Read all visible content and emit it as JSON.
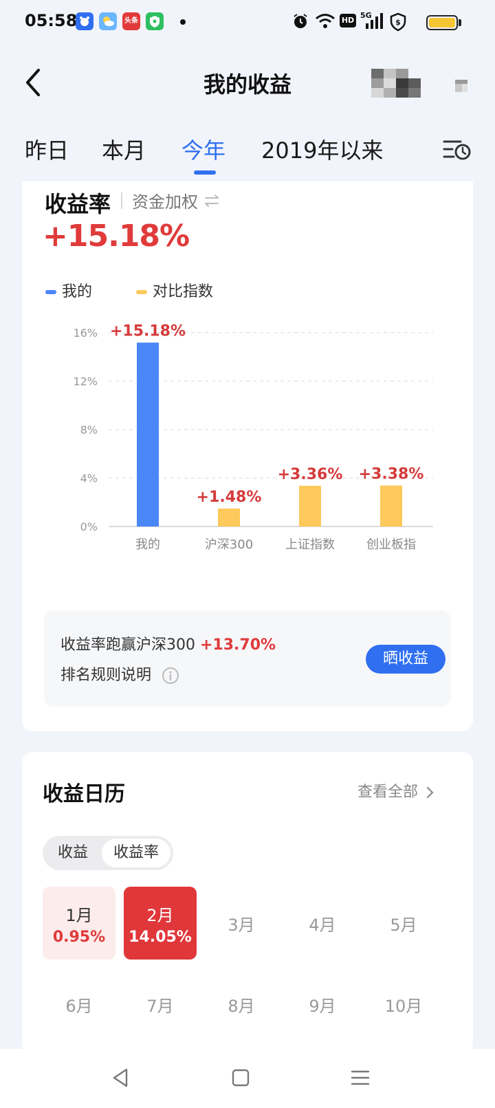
{
  "status_bar": {
    "time": "05:58",
    "icons": [
      "baidu-app-icon",
      "weather-app-icon",
      "toutiao-app-icon",
      "security-app-icon",
      "alarm-icon",
      "wifi-icon",
      "hd-icon",
      "signal-5g-icon",
      "shield-dollar-icon",
      "battery-icon"
    ],
    "toutiao_label": "头条",
    "hd_label": "HD",
    "net_label": "5G"
  },
  "header": {
    "title": "我的收益"
  },
  "tabs": [
    {
      "label": "昨日",
      "active": false
    },
    {
      "label": "本月",
      "active": false
    },
    {
      "label": "今年",
      "active": true
    },
    {
      "label": "2019年以来",
      "active": false
    }
  ],
  "rate_card": {
    "title": "收益率",
    "subtitle": "资金加权",
    "value": "+15.18%",
    "legend": [
      {
        "label": "我的",
        "color": "#4a86f6"
      },
      {
        "label": "对比指数",
        "color": "#fcc95a"
      }
    ]
  },
  "chart_data": {
    "type": "bar",
    "categories": [
      "我的",
      "沪深300",
      "上证指数",
      "创业板指"
    ],
    "values": [
      15.18,
      1.48,
      3.36,
      3.38
    ],
    "value_labels": [
      "+15.18%",
      "+1.48%",
      "+3.36%",
      "+3.38%"
    ],
    "colors": [
      "#4a86f6",
      "#fcc95a",
      "#fcc95a",
      "#fcc95a"
    ],
    "yticks": [
      "0%",
      "4%",
      "8%",
      "12%",
      "16%"
    ],
    "ylim": [
      0,
      16
    ],
    "grid": true,
    "label_color": "#d63a3a"
  },
  "compare": {
    "text": "收益率跑赢沪深300",
    "diff": "+13.70%",
    "rules": "排名规则说明",
    "share_button": "晒收益"
  },
  "calendar": {
    "title": "收益日历",
    "view_all": "查看全部",
    "toggle": [
      {
        "label": "收益",
        "selected": false
      },
      {
        "label": "收益率",
        "selected": true
      }
    ],
    "months_row1": [
      {
        "name": "1月",
        "value": "0.95%",
        "style": "light"
      },
      {
        "name": "2月",
        "value": "14.05%",
        "style": "strong"
      },
      {
        "name": "3月",
        "value": "",
        "style": "plain"
      },
      {
        "name": "4月",
        "value": "",
        "style": "plain"
      },
      {
        "name": "5月",
        "value": "",
        "style": "plain"
      }
    ],
    "months_row2": [
      {
        "name": "6月",
        "value": "",
        "style": "plain"
      },
      {
        "name": "7月",
        "value": "",
        "style": "plain"
      },
      {
        "name": "8月",
        "value": "",
        "style": "plain"
      },
      {
        "name": "9月",
        "value": "",
        "style": "plain"
      },
      {
        "name": "10月",
        "value": "",
        "style": "plain"
      }
    ]
  },
  "nav_bar": {
    "buttons": [
      "back-triangle-icon",
      "home-square-icon",
      "menu-lines-icon"
    ]
  }
}
